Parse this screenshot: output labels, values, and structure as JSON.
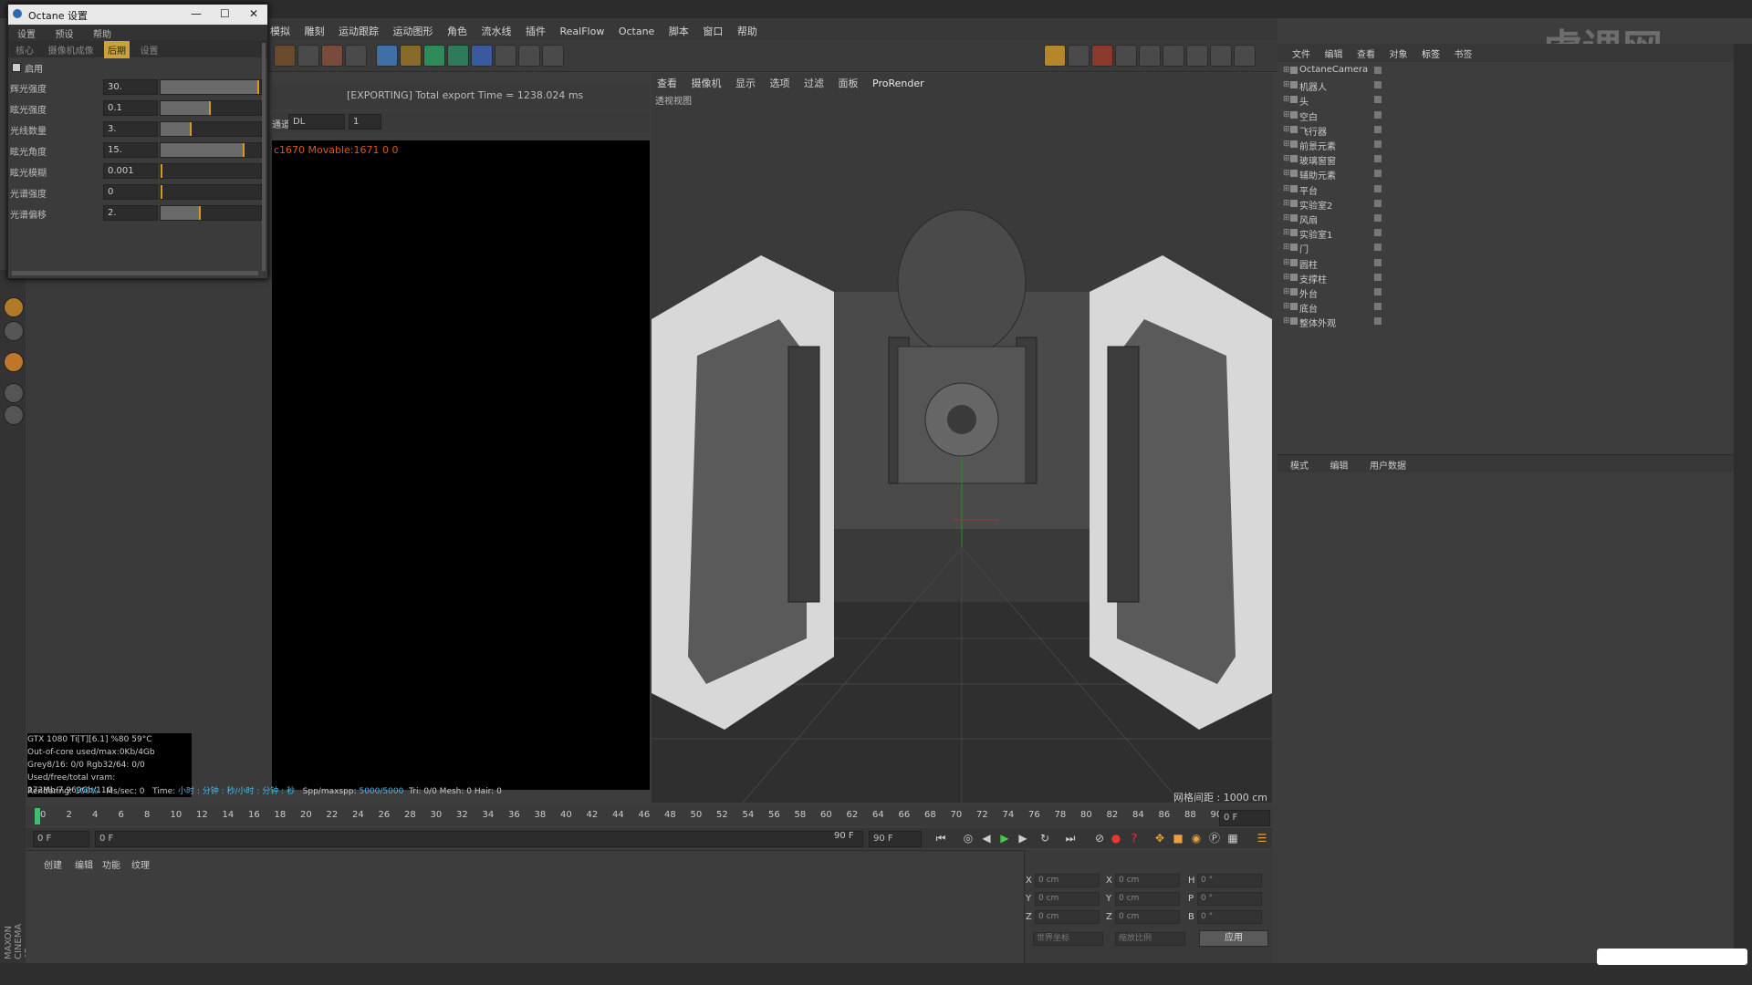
{
  "menubar": [
    "模拟",
    "雕刻",
    "运动跟踪",
    "运动图形",
    "角色",
    "流水线",
    "插件",
    "RealFlow",
    "Octane",
    "脚本",
    "窗口",
    "帮助"
  ],
  "octane_window": {
    "title": "Octane 设置",
    "menu": [
      "设置",
      "预设",
      "帮助"
    ],
    "tabs": [
      "核心",
      "摄像机成像",
      "后期",
      "设置"
    ],
    "active_tab": "后期",
    "enable_label": "启用",
    "params": [
      {
        "label": "辉光强度",
        "value": "30.",
        "fill": 1.0
      },
      {
        "label": "眩光强度",
        "value": "0.1",
        "fill": 0.5
      },
      {
        "label": "光线数量",
        "value": "3.",
        "fill": 0.3
      },
      {
        "label": "眩光角度",
        "value": "15.",
        "fill": 0.85
      },
      {
        "label": "眩光模糊",
        "value": "0.001",
        "fill": 0.0
      },
      {
        "label": "光谱强度",
        "value": "0",
        "fill": 0.0
      },
      {
        "label": "光谱偏移",
        "value": "2.",
        "fill": 0.4
      }
    ]
  },
  "render_viewer": {
    "status": "[EXPORTING] Total export Time = 1238.024 ms",
    "filter_label": "通道:",
    "filter_value": "DL",
    "filter_num": "1",
    "orange_text": "c1670 Movable:1671  0 0",
    "gpu": [
      "GTX 1080 Ti[T][6.1]        %80       59°C",
      "Out-of-core used/max:0Kb/4Gb",
      "Grey8/16: 0/0          Rgb32/64: 0/0",
      "Used/free/total vram: 272Mb/7.969Gb/11G"
    ],
    "render_line": {
      "rendering": "Rendering:",
      "pct": "100%",
      "ms": "Ms/sec: 0",
      "time": "Time:",
      "time_val": "小时 : 分钟 : 秒/小时 : 分钟 : 秒",
      "spp": "Spp/maxspp:",
      "spp_val": "5000/5000",
      "rest": "Tri: 0/0   Mesh: 0     Hair: 0"
    }
  },
  "viewport": {
    "menu": [
      "查看",
      "摄像机",
      "显示",
      "选项",
      "过滤",
      "面板",
      "ProRender"
    ],
    "label": "透视视图",
    "grid": "网格间距 : 1000 cm"
  },
  "timeline": {
    "ticks": [
      "0",
      "2",
      "4",
      "6",
      "8",
      "10",
      "12",
      "14",
      "16",
      "18",
      "20",
      "22",
      "24",
      "26",
      "28",
      "30",
      "32",
      "34",
      "36",
      "38",
      "40",
      "42",
      "44",
      "46",
      "48",
      "50",
      "52",
      "54",
      "56",
      "58",
      "60",
      "62",
      "64",
      "66",
      "68",
      "70",
      "72",
      "74",
      "76",
      "78",
      "80",
      "82",
      "84",
      "86",
      "88",
      "90"
    ],
    "current": "0 F",
    "start": "0 F",
    "slider": "0 F",
    "end_a": "90 F",
    "end_b": "90 F"
  },
  "bottom_tabs": [
    "创建",
    "编辑",
    "功能",
    "纹理"
  ],
  "coords": {
    "rows": [
      {
        "a": "X",
        "av": "0 cm",
        "b": "X",
        "bv": "0 cm",
        "c": "H",
        "cv": "0 °"
      },
      {
        "a": "Y",
        "av": "0 cm",
        "b": "Y",
        "bv": "0 cm",
        "c": "P",
        "cv": "0 °"
      },
      {
        "a": "Z",
        "av": "0 cm",
        "b": "Z",
        "bv": "0 cm",
        "c": "B",
        "cv": "0 °"
      }
    ],
    "mode1": "世界坐标",
    "mode2": "缩放比例",
    "apply": "应用"
  },
  "object_manager": {
    "menu": [
      "文件",
      "编辑",
      "查看",
      "对象",
      "标签",
      "书签"
    ],
    "objects": [
      "OctaneCamera",
      "机器人",
      "头",
      "空白",
      "飞行器",
      "前景元素",
      "玻璃窗窗",
      "辅助元素",
      "平台",
      "实验室2",
      "风扇",
      "实验室1",
      "门",
      "圆柱",
      "支撑柱",
      "外台",
      "底台",
      "整体外观"
    ]
  },
  "attribute_manager": {
    "menu": [
      "模式",
      "编辑",
      "用户数据"
    ]
  },
  "brand": "MAXON CINEMA 4D"
}
